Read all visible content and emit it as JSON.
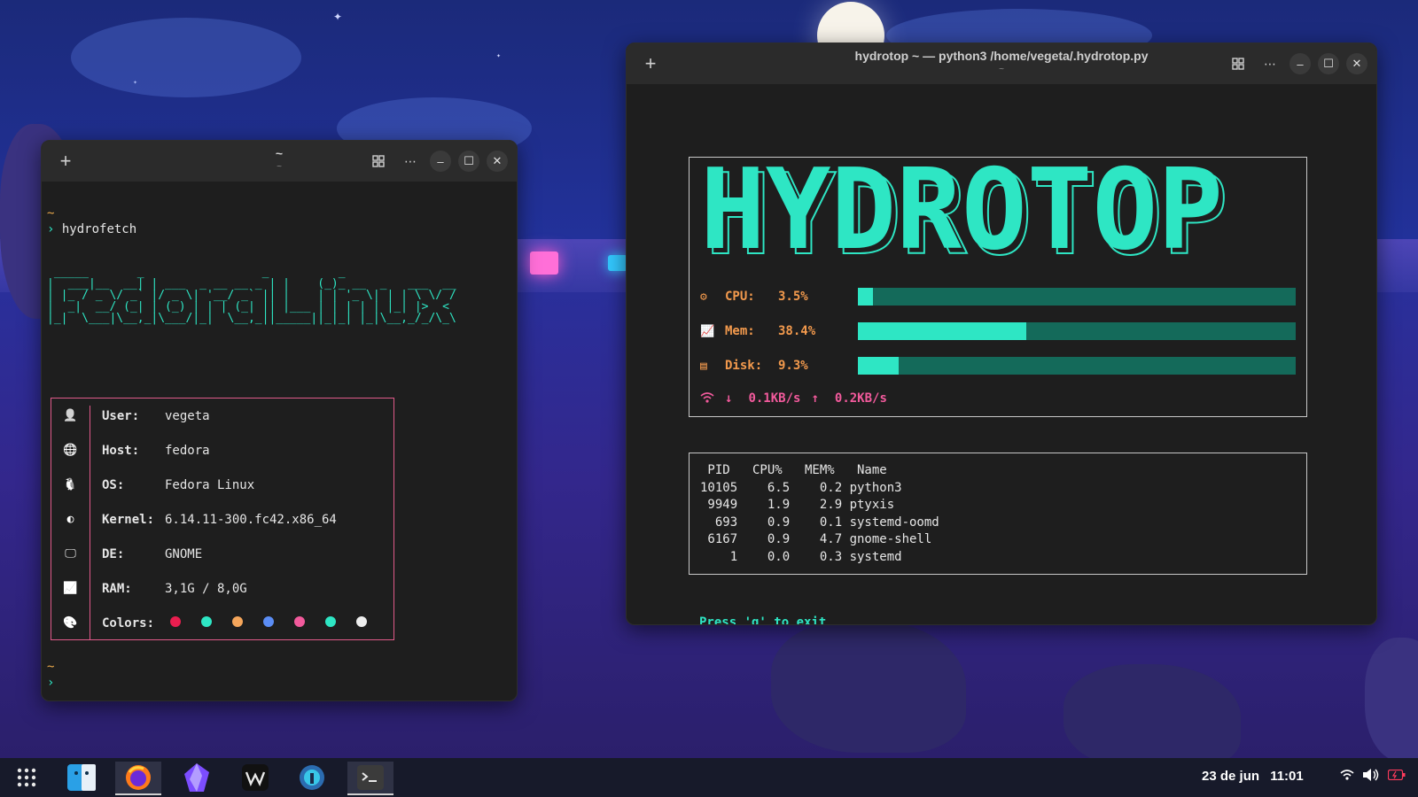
{
  "left_window": {
    "title": "~",
    "subtitle": "~",
    "prompt_tilde": "~",
    "prompt_arrow": "›",
    "command": "hydrofetch",
    "ascii_logo": " _____       _                 _          _\n|  ___|__  __| | ___  _ __ __ _ | |    (_)_ __  _   ___  __\n| |_ / _ \\/ _` |/ _ \\| '__/ _` || |    | | '_ \\| | | \\ \\/ /\n|  _|  __/ (_| | (_) | | | (_| || |___ | | | | | |_| |>  <\n|_|  \\___|\\__,_|\\___/|_|  \\__,_||_____||_|_| |_|\\__,_/_/\\_\\",
    "info": [
      {
        "icon": "user-icon",
        "key": "User:",
        "value": "vegeta"
      },
      {
        "icon": "globe-icon",
        "key": "Host:",
        "value": "fedora"
      },
      {
        "icon": "linux-icon",
        "key": "OS:",
        "value": "Fedora Linux"
      },
      {
        "icon": "kernel-icon",
        "key": "Kernel:",
        "value": "6.14.11-300.fc42.x86_64"
      },
      {
        "icon": "monitor-icon",
        "key": "DE:",
        "value": "GNOME"
      },
      {
        "icon": "chart-icon",
        "key": "RAM:",
        "value": "3,1G / 8,0G"
      },
      {
        "icon": "palette-icon",
        "key": "Colors:",
        "value": ""
      }
    ],
    "colors": [
      "#e91e4f",
      "#2ee6c4",
      "#f5a65b",
      "#5b8df5",
      "#f25a9c",
      "#2ee6c4",
      "#eeeeee"
    ],
    "end_tilde": "~",
    "end_arrow": "›"
  },
  "right_window": {
    "title": "hydrotop ~ — python3 /home/vegeta/.hydrotop.py",
    "subtitle": "~",
    "logo_text": "HYDROTOP",
    "metrics": [
      {
        "icon": "cpu-icon",
        "label": "CPU:",
        "value": "3.5%",
        "fraction": 0.035
      },
      {
        "icon": "mem-icon",
        "label": "Mem:",
        "value": "38.4%",
        "fraction": 0.384
      },
      {
        "icon": "disk-icon",
        "label": "Disk:",
        "value": "9.3%",
        "fraction": 0.093
      }
    ],
    "network": {
      "down_arrow": "↓",
      "down": "0.1KB/s",
      "up_arrow": "↑",
      "up": "0.2KB/s"
    },
    "process_table": " PID   CPU%   MEM%   Name\n10105    6.5    0.2 python3\n 9949    1.9    2.9 ptyxis\n  693    0.9    0.1 systemd-oomd\n 6167    0.9    4.7 gnome-shell\n    1    0.0    0.3 systemd",
    "exit_hint": "Press 'q' to exit"
  },
  "taskbar": {
    "apps": [
      "app-grid-icon",
      "files-icon",
      "firefox-icon",
      "obsidian-icon",
      "warp-icon",
      "flatseal-icon",
      "terminal-icon"
    ],
    "date": "23 de jun",
    "time": "11:01"
  },
  "colors": {
    "accent": "#2ee6c4",
    "pink": "#f25a9c",
    "orange": "#f39a4d"
  }
}
